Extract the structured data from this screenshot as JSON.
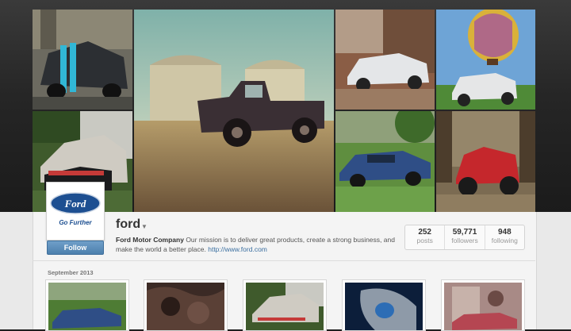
{
  "profile": {
    "username": "ford",
    "display_name": "Ford Motor Company",
    "bio": " Our mission is to deliver great products, create a strong business, and make the world a better place. ",
    "website": "http://www.ford.com",
    "logo_text": "Ford",
    "tagline": "Go Further",
    "follow_label": "Follow"
  },
  "stats": [
    {
      "value": "252",
      "label": "posts"
    },
    {
      "value": "59,771",
      "label": "followers"
    },
    {
      "value": "948",
      "label": "following"
    }
  ],
  "feed": {
    "month_header": "September 2013"
  },
  "colors": {
    "ford_blue": "#1d4f91",
    "follow_button": "#5a8cba",
    "link": "#3b6fa0"
  },
  "icons": {
    "dropdown": "caret-down-icon"
  }
}
